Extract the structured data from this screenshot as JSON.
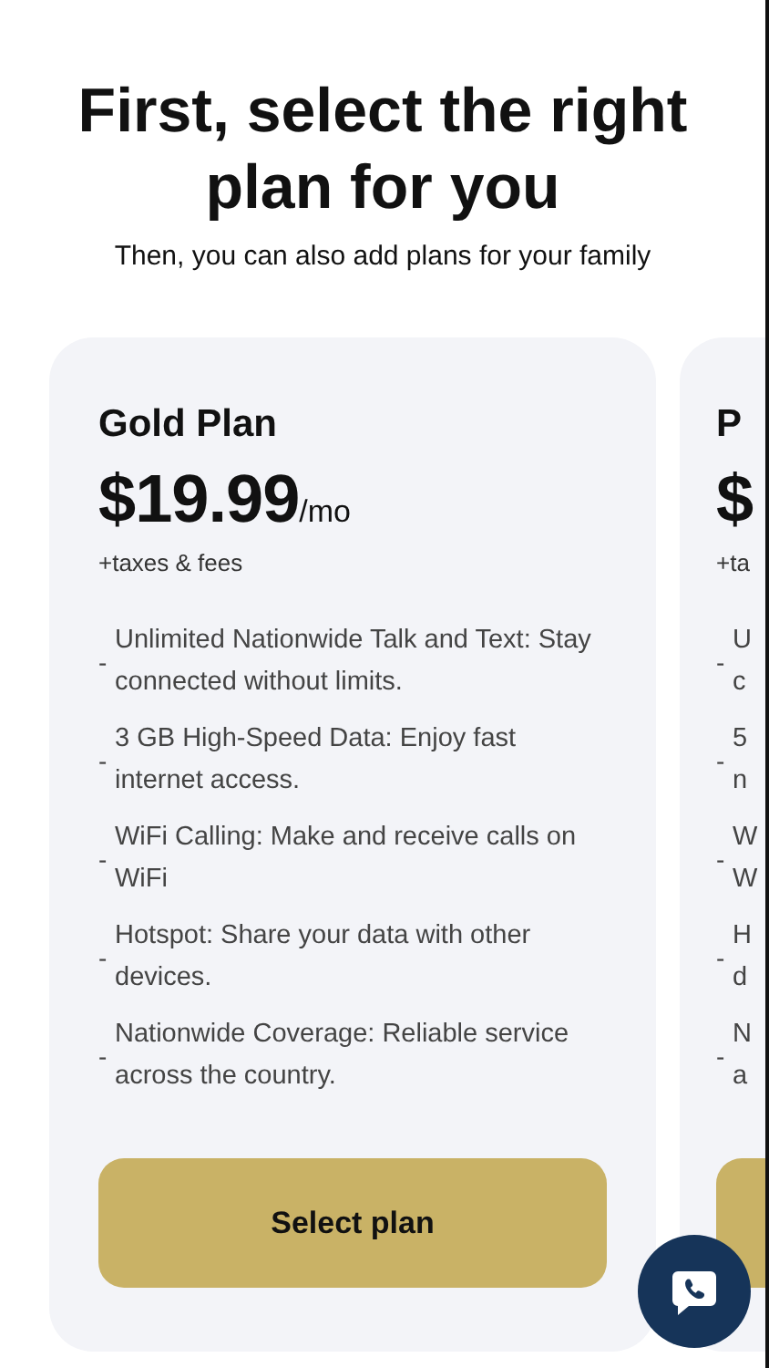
{
  "heading": {
    "title": "First, select the right plan for you",
    "subtitle": "Then, you can also add plans for your family"
  },
  "plans": [
    {
      "name": "Gold Plan",
      "price": "$19.99",
      "period": "/mo",
      "fees": "+taxes & fees",
      "button": "Select plan",
      "features": [
        {
          "marker": "-",
          "lines": [
            "Unlimited Nationwide Talk and Text: Stay",
            "connected without limits."
          ]
        },
        {
          "marker": "-",
          "lines": [
            "3 GB High-Speed Data: Enjoy fast",
            "internet access."
          ]
        },
        {
          "marker": "-",
          "lines": [
            "WiFi Calling: Make and receive calls on",
            "WiFi"
          ]
        },
        {
          "marker": "-",
          "lines": [
            "Hotspot: Share your data with other",
            "devices."
          ]
        },
        {
          "marker": "-",
          "lines": [
            "Nationwide Coverage: Reliable service",
            "across the country."
          ]
        }
      ]
    },
    {
      "name": "P",
      "price": "$",
      "fees": "+ta",
      "features": [
        {
          "marker": "-",
          "lines": [
            "U",
            "c"
          ]
        },
        {
          "marker": "-",
          "lines": [
            "5",
            "n"
          ]
        },
        {
          "marker": "-",
          "lines": [
            "W",
            "W"
          ]
        },
        {
          "marker": "-",
          "lines": [
            "H",
            "d"
          ]
        },
        {
          "marker": "-",
          "lines": [
            "N",
            "a"
          ]
        }
      ]
    }
  ]
}
